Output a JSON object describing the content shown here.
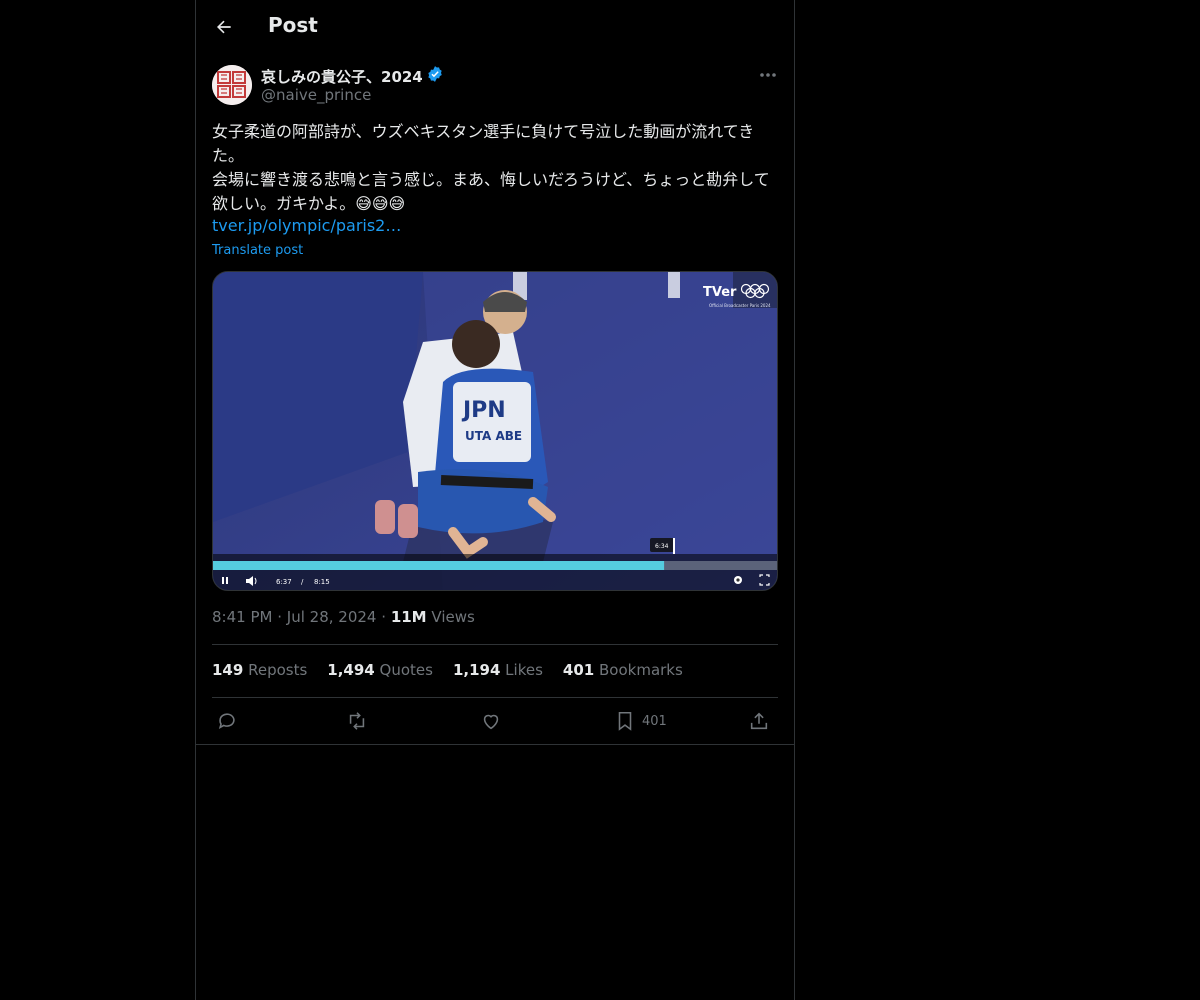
{
  "header": {
    "title": "Post"
  },
  "author": {
    "name": "哀しみの貴公子、2024",
    "handle": "@naive_prince",
    "verified": true
  },
  "tweet": {
    "text": "女子柔道の阿部詩が、ウズベキスタン選手に負けて号泣した動画が流れてきた。\n会場に響き渡る悲鳴と言う感じ。まあ、悔しいだろうけど、ちょっと勘弁して欲しい。ガキかよ。😅😅😅",
    "link": "tver.jp/olympic/paris2…",
    "translate": "Translate post"
  },
  "video": {
    "logo": "TVer",
    "overlay_caption": "Official Broadcaster Paris 2024",
    "hover_time": "6:34",
    "current_time": "6:37",
    "time_sep": "/",
    "duration": "8:15",
    "progress": 0.797,
    "bib_text": "JPN",
    "bib_name": "UTA ABE"
  },
  "meta": {
    "time": "8:41 PM",
    "sep": "·",
    "date": "Jul 28, 2024",
    "views_count": "11M",
    "views_label": "Views"
  },
  "stats": {
    "reposts_count": "149",
    "reposts_label": "Reposts",
    "quotes_count": "1,494",
    "quotes_label": "Quotes",
    "likes_count": "1,194",
    "likes_label": "Likes",
    "bookmarks_count": "401",
    "bookmarks_label": "Bookmarks"
  },
  "actions": {
    "bookmark_count": "401"
  },
  "colors": {
    "background": "#000000",
    "text": "#e7e9ea",
    "muted": "#71767b",
    "accent": "#1d9bf0",
    "border": "#2f3336",
    "progress": "#55cde0"
  },
  "icons": [
    "back-arrow-icon",
    "verified-badge-icon",
    "more-icon",
    "reply-icon",
    "repost-icon",
    "like-icon",
    "bookmark-icon",
    "share-icon",
    "pause-icon",
    "volume-icon",
    "settings-icon",
    "fullscreen-icon"
  ]
}
